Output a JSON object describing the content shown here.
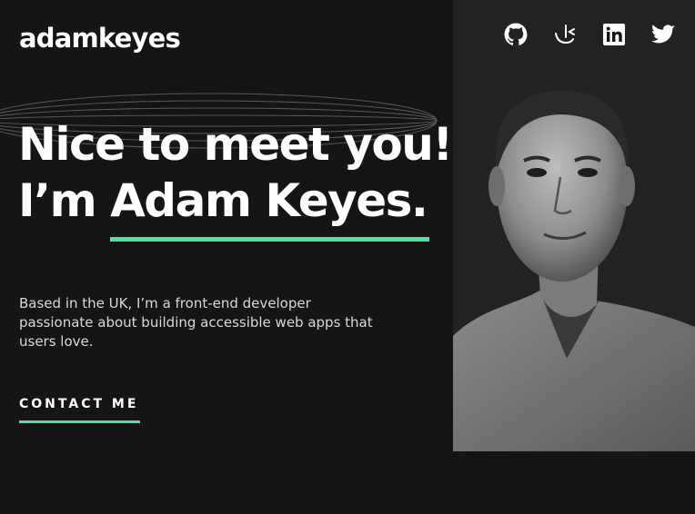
{
  "header": {
    "logo": "adamkeyes",
    "socials": [
      {
        "label": "GitHub",
        "icon": "github-icon"
      },
      {
        "label": "Frontend Mentor",
        "icon": "frontend-mentor-icon"
      },
      {
        "label": "LinkedIn",
        "icon": "linkedin-icon"
      },
      {
        "label": "Twitter",
        "icon": "twitter-icon"
      }
    ]
  },
  "hero": {
    "greeting": "Nice to meet you!",
    "intro_prefix": "I’m ",
    "name": "Adam Keyes.",
    "bio": "Based in the UK, I’m a front-end developer passionate about building accessible web apps that users love.",
    "cta": "CONTACT ME"
  },
  "colors": {
    "background": "#151515",
    "panel": "#242424",
    "accent": "#4ee1a0",
    "text": "#ffffff",
    "muted": "#d9d9d9"
  }
}
